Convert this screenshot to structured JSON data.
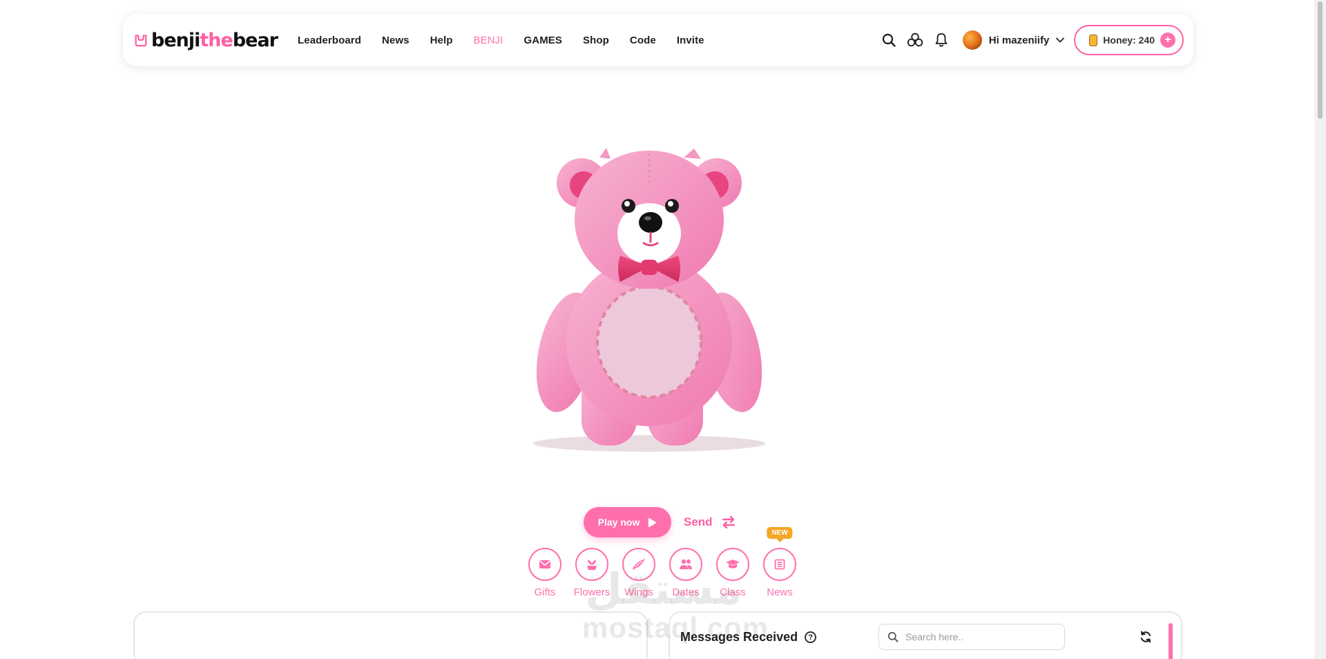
{
  "header": {
    "logo": {
      "part1": "benji",
      "part2": "the",
      "part3": "bear"
    },
    "nav": [
      {
        "label": "Leaderboard",
        "active": false
      },
      {
        "label": "News",
        "active": false
      },
      {
        "label": "Help",
        "active": false
      },
      {
        "label": "BENJI",
        "active": true
      },
      {
        "label": "GAMES",
        "active": false
      },
      {
        "label": "Shop",
        "active": false
      },
      {
        "label": "Code",
        "active": false
      },
      {
        "label": "Invite",
        "active": false
      }
    ],
    "icons": [
      "search-icon",
      "friends-icon",
      "bell-icon"
    ],
    "user": {
      "greeting": "Hi mazeniify"
    },
    "honey": {
      "label": "Honey: 240"
    }
  },
  "actions": {
    "play_label": "Play now",
    "send_label": "Send"
  },
  "categories": [
    {
      "label": "Gifts",
      "icon": "envelope-icon"
    },
    {
      "label": "Flowers",
      "icon": "flower-icon"
    },
    {
      "label": "Wings",
      "icon": "wing-icon"
    },
    {
      "label": "Dates",
      "icon": "people-icon"
    },
    {
      "label": "Class",
      "icon": "graduation-cap-icon"
    },
    {
      "label": "News",
      "icon": "newspaper-icon",
      "badge": "NEW"
    }
  ],
  "messages": {
    "title": "Messages Received",
    "search_placeholder": "Search here.."
  },
  "watermark": {
    "arabic": "مستقل",
    "latin": "mostaql.com"
  },
  "colors": {
    "accent": "#ff6fae",
    "badge": "#f5a623"
  }
}
